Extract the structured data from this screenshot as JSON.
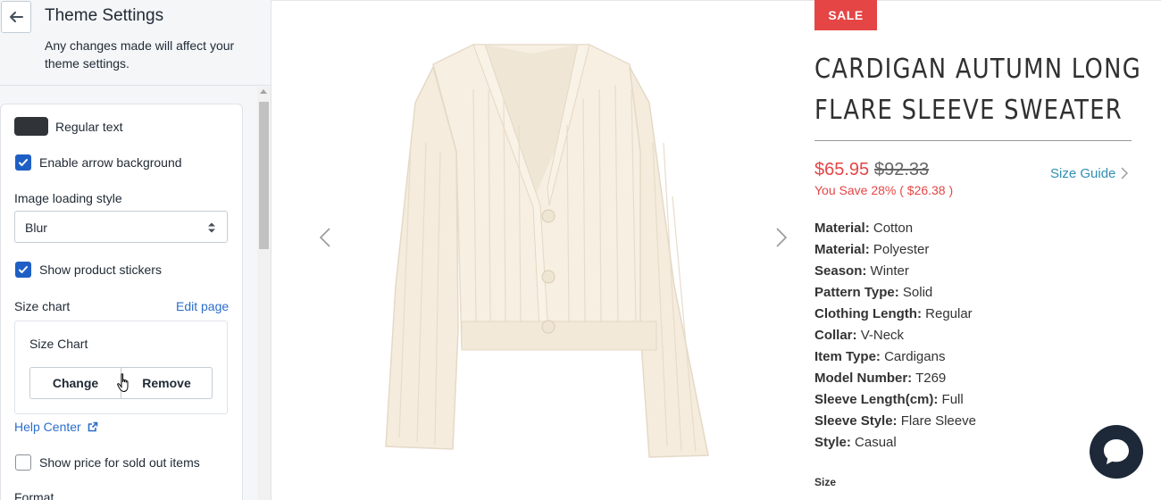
{
  "sidebar": {
    "title": "Theme Settings",
    "description": "Any changes made will affect your theme settings.",
    "color_setting": {
      "label": "Regular text",
      "swatch_color": "#303438"
    },
    "enable_arrow_background": {
      "label": "Enable arrow background",
      "checked": true
    },
    "image_loading_style": {
      "label": "Image loading style",
      "value": "Blur"
    },
    "show_product_stickers": {
      "label": "Show product stickers",
      "checked": true
    },
    "size_chart": {
      "label": "Size chart",
      "edit_link": "Edit page",
      "page_name": "Size Chart",
      "change_label": "Change",
      "remove_label": "Remove"
    },
    "help_center": "Help Center",
    "show_price_sold_out": {
      "label": "Show price for sold out items",
      "checked": false
    },
    "format_label": "Format"
  },
  "product": {
    "badge": "SALE",
    "title_line1": "CARDIGAN AUTUMN LONG",
    "title_line2": "FLARE SLEEVE SWEATER",
    "price": "$65.95",
    "compare_price": "$92.33",
    "savings": "You Save 28% ( $26.38 )",
    "size_guide": "Size Guide",
    "specs": [
      {
        "key": "Material:",
        "value": "Cotton"
      },
      {
        "key": "Material:",
        "value": "Polyester"
      },
      {
        "key": "Season:",
        "value": "Winter"
      },
      {
        "key": "Pattern Type:",
        "value": "Solid"
      },
      {
        "key": "Clothing Length:",
        "value": "Regular"
      },
      {
        "key": "Collar:",
        "value": "V-Neck"
      },
      {
        "key": "Item Type:",
        "value": "Cardigans"
      },
      {
        "key": "Model Number:",
        "value": "T269"
      },
      {
        "key": "Sleeve Length(cm):",
        "value": "Full"
      },
      {
        "key": "Sleeve Style:",
        "value": "Flare Sleeve"
      },
      {
        "key": "Style:",
        "value": "Casual"
      }
    ],
    "size_label": "Size",
    "colors": {
      "sale_red": "#e54545",
      "link_teal": "#2f8eb0",
      "admin_blue": "#2c6ecb"
    }
  }
}
